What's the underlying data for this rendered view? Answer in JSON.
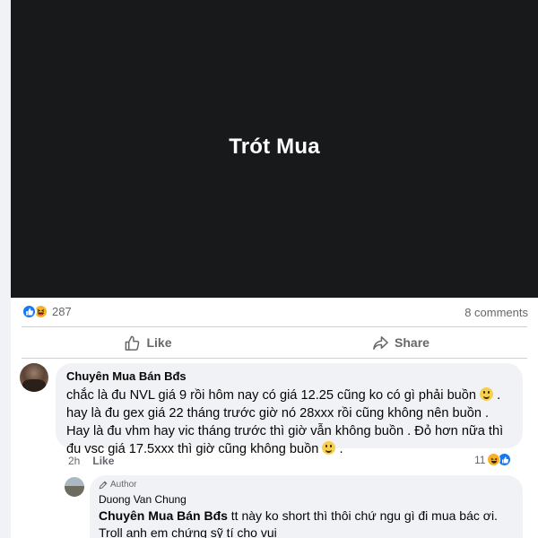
{
  "post": {
    "media_text": "Trót Mua",
    "reaction_count": "287",
    "comments_count": "8 comments"
  },
  "actions": {
    "like_label": "Like",
    "share_label": "Share"
  },
  "comment": {
    "author": "Chuyên Mua Bán Bđs",
    "text_part1": "chắc là đu NVL giá 9 rồi hôm nay có giá 12.25 cũng ko có gì phải buồn",
    "text_part2": ". hay là đu gex giá 22 tháng trước giờ nó 28xxx rồi cũng không nên buồn . Hay là đu vhm hay vic tháng trước thì giờ vẫn không buồn . Đỏ hơn nữa thì đu vsc giá 17.5xxx thì giờ cũng không buồn",
    "text_part3": ".",
    "time": "2h",
    "like_label": "Like",
    "reaction_count": "11"
  },
  "reply": {
    "badge": "Author",
    "author": "Duong Van Chung",
    "mention": "Chuyên Mua Bán Bđs",
    "text": " tt này ko short thì thôi chứ ngu gì đi mua bác ơi. Troll anh em chứng sỹ tí cho vui"
  },
  "colors": {
    "like_blue": "#1877f2",
    "haha_yellow": "#f7b125",
    "media_bg": "#18191a",
    "secondary_text": "#65676b"
  }
}
